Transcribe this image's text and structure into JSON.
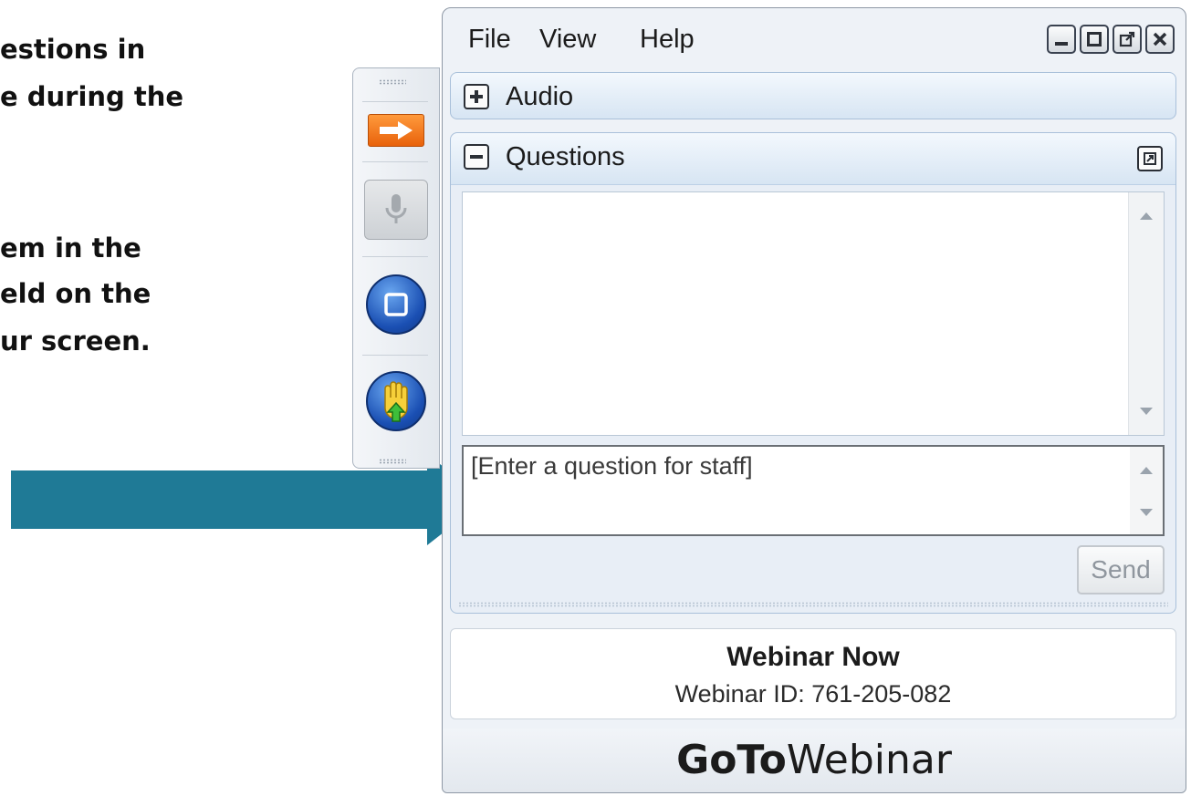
{
  "instructions": {
    "line1": "estions in",
    "line2": "e during the",
    "line3": "em in the",
    "line4": "eld on the",
    "line5": "ur screen."
  },
  "colors": {
    "arrow": "#1f7a96",
    "orange_button": "#f07a1e",
    "blue_button": "#1f5dbf",
    "panel_header": "#dbe8f5"
  },
  "toolbar": {
    "icons": [
      "arrow-right-icon",
      "microphone-icon",
      "screen-icon",
      "raise-hand-icon"
    ]
  },
  "menu": {
    "items": [
      "File",
      "View",
      "Help"
    ]
  },
  "window_controls": [
    "minimize-icon",
    "maximize-icon",
    "popout-icon",
    "close-icon"
  ],
  "audio_panel": {
    "title": "Audio"
  },
  "questions_panel": {
    "title": "Questions",
    "input_placeholder": "[Enter a question for staff]",
    "send_label": "Send"
  },
  "webinar": {
    "title": "Webinar Now",
    "id_text": "Webinar ID: 761-205-082"
  },
  "brand": {
    "bold": "GoTo",
    "light": "Webinar"
  }
}
